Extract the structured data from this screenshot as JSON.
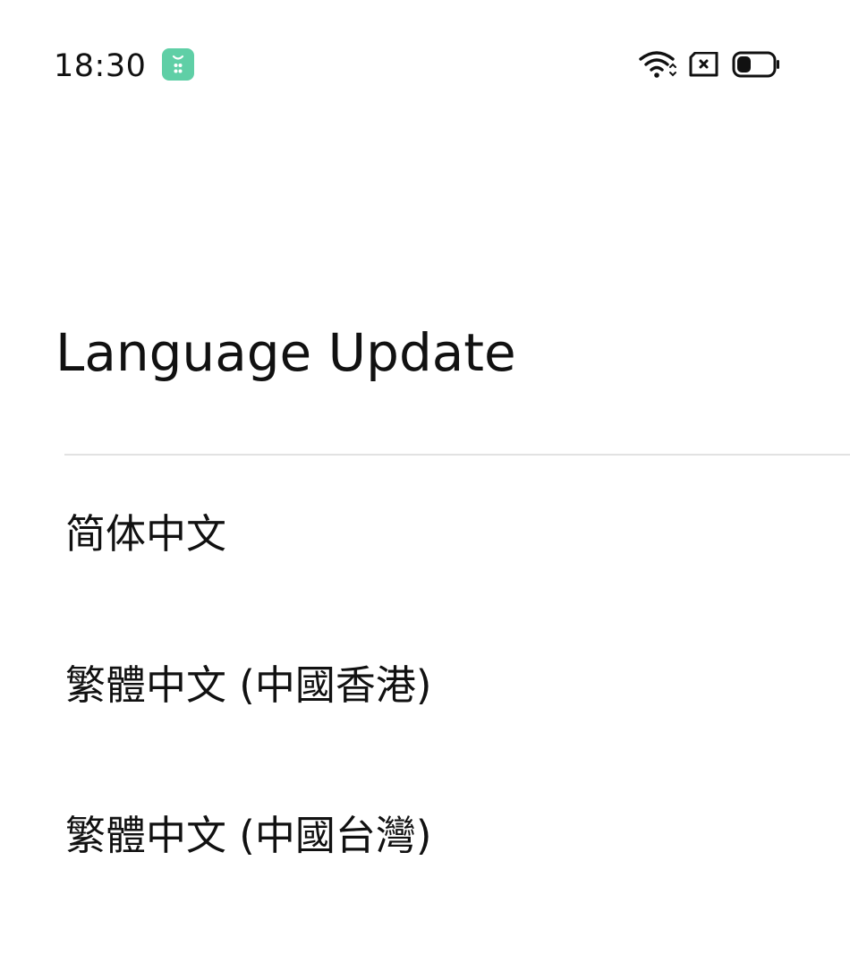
{
  "status_bar": {
    "time": "18:30",
    "icons": {
      "app": "app-notification-icon",
      "wifi": "wifi-icon",
      "sim": "no-sim-icon",
      "battery": "battery-icon"
    },
    "app_icon_color": "#5fcfa6",
    "battery_level": 0.4
  },
  "page": {
    "title": "Language Update"
  },
  "languages": [
    {
      "label": "简体中文"
    },
    {
      "label": "繁體中文 (中國香港)"
    },
    {
      "label": "繁體中文 (中國台灣)"
    }
  ],
  "colors": {
    "background": "#ffffff",
    "text": "#111111",
    "divider": "#e2e2e2"
  }
}
